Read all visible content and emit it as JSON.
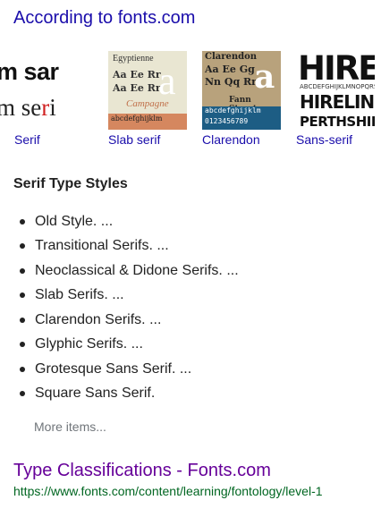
{
  "header": {
    "link": "According to fonts.com"
  },
  "thumbnails": [
    {
      "caption": "Serif",
      "line1": "m sar",
      "line2a": "m se",
      "line2b": "r",
      "line2c": "i"
    },
    {
      "caption": "Slab serif",
      "line1": "Egyptienne",
      "line2": "Aa Ee Rr",
      "line3": "Aa Ee Rr",
      "big": "a",
      "italic": "Campagne",
      "line5": "abcdefghijklm"
    },
    {
      "caption": "Clarendon",
      "line1": "Clarendon",
      "line2": "Aa Ee Gg",
      "line3": "Nn Qq Rr",
      "big": "a",
      "line4": "Fann Street",
      "line5": "abcdefghijklm",
      "line6": "0123456789"
    },
    {
      "caption": "Sans-serif",
      "line1": "HIRE",
      "line2": "ABCDEFGHIJKLMNOPQRST",
      "line3": "HIRELINC",
      "line4": "PERTHSHIRE"
    }
  ],
  "section": {
    "title": "Serif Type Styles",
    "items": [
      "Old Style. ...",
      "Transitional Serifs. ...",
      "Neoclassical & Didone Serifs. ...",
      "Slab Serifs. ...",
      "Clarendon Serifs. ...",
      "Glyphic Serifs. ...",
      "Grotesque Sans Serif. ...",
      "Square Sans Serif."
    ],
    "more": "More items..."
  },
  "result": {
    "title": "Type Classifications - Fonts.com",
    "url": "https://www.fonts.com/content/learning/fontology/level-1"
  },
  "colors": {
    "link": "#1a0dab",
    "visited": "#660099",
    "url": "#006621",
    "muted": "#70757a"
  }
}
